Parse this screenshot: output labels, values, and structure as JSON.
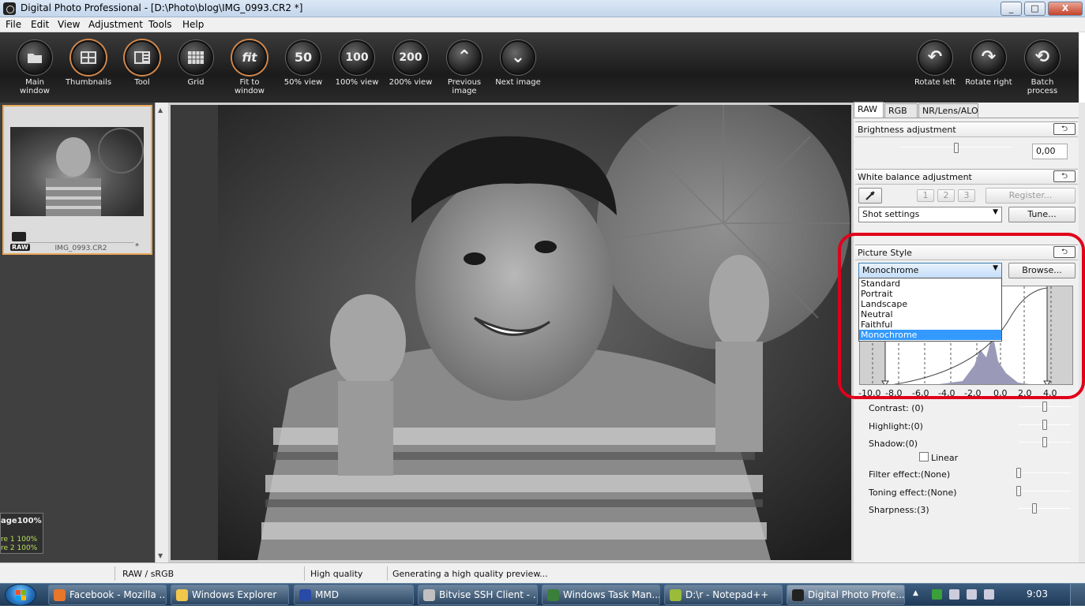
{
  "window": {
    "title": "Digital Photo Professional - [D:\\Photo\\blog\\IMG_0993.CR2 *]",
    "min": "_",
    "max": "□",
    "close": "X"
  },
  "menu": [
    "File",
    "Edit",
    "View",
    "Adjustment",
    "Tools",
    "Help"
  ],
  "toolbar": [
    {
      "label": "Main window",
      "icon": "folder-icon"
    },
    {
      "label": "Thumbnails",
      "icon": "thumbnails-icon"
    },
    {
      "label": "Tool",
      "icon": "tool-icon"
    },
    {
      "label": "Grid",
      "icon": "grid-icon"
    },
    {
      "label": "Fit to window",
      "icon": "fit",
      "text": "fit"
    },
    {
      "label": "50% view",
      "text": "50"
    },
    {
      "label": "100% view",
      "text": "100"
    },
    {
      "label": "200% view",
      "text": "200"
    },
    {
      "label": "Previous image",
      "text": "⌃"
    },
    {
      "label": "Next image",
      "text": "⌄"
    },
    {
      "label": "Rotate left",
      "text": "↶"
    },
    {
      "label": "Rotate right",
      "text": "↷"
    },
    {
      "label": "Batch process",
      "text": "⟲"
    }
  ],
  "thumbnail": {
    "name": "IMG_0993.CR2",
    "badge": "RAW",
    "star": "*"
  },
  "zoom_info": {
    "title": "age100%",
    "line1": "re 1   100%",
    "line2": "re 2   100%"
  },
  "tabs": [
    "RAW",
    "RGB",
    "NR/Lens/ALO"
  ],
  "brightness": {
    "title": "Brightness adjustment",
    "value": "0,00",
    "level": 0.5
  },
  "white_balance": {
    "title": "White balance adjustment",
    "presets": [
      "1",
      "2",
      "3"
    ],
    "register": "Register...",
    "shot_settings": "Shot settings",
    "tune": "Tune..."
  },
  "picture_style": {
    "title": "Picture Style",
    "selected": "Monochrome",
    "browse": "Browse...",
    "options": [
      "Standard",
      "Portrait",
      "Landscape",
      "Neutral",
      "Faithful",
      "Monochrome"
    ],
    "axis": [
      "-10,0",
      "-8,0",
      "-6,0",
      "-4,0",
      "-2,0",
      "0,0",
      "2,0",
      "4,0"
    ]
  },
  "adjustments": [
    {
      "label": "Contrast: (0)",
      "level": 0.5
    },
    {
      "label": "Highlight:(0)",
      "level": 0.5
    },
    {
      "label": "Shadow:(0)",
      "level": 0.5
    },
    {
      "label": "Filter effect:(None)",
      "level": 0
    },
    {
      "label": "Toning effect:(None)",
      "level": 0
    },
    {
      "label": "Sharpness:(3)",
      "level": 0.3
    }
  ],
  "linear_label": "Linear",
  "status": {
    "color": "RAW / sRGB",
    "quality": "High quality",
    "message": "Generating a high quality preview..."
  },
  "taskbar": [
    {
      "label": "Facebook - Mozilla ...",
      "color": "#e8762b"
    },
    {
      "label": "Windows Explorer",
      "color": "#f1c74c"
    },
    {
      "label": "MMD",
      "color": "#2a4aa8"
    },
    {
      "label": "Bitvise SSH Client - ...",
      "color": "#c0c0c0"
    },
    {
      "label": "Windows Task Man...",
      "color": "#3a7f3a"
    },
    {
      "label": "D:\\r - Notepad++",
      "color": "#9bbb3b"
    },
    {
      "label": "Digital Photo Profe...",
      "color": "#222222"
    }
  ],
  "clock": "9:03"
}
